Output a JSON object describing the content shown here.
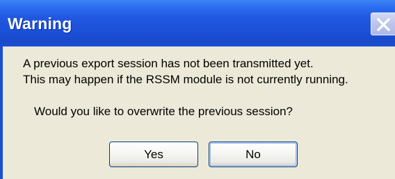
{
  "window": {
    "title": "Warning",
    "close_icon": "close-icon"
  },
  "message": {
    "line1": "A previous export session has not been transmitted yet.",
    "line2": "This may happen if the RSSM module is not currently running.",
    "question": "Would you like to overwrite the previous session?"
  },
  "buttons": {
    "yes_label": "Yes",
    "no_label": "No"
  },
  "colors": {
    "titlebar": "#2158e2",
    "client": "#ece9d8",
    "button_border": "#003c74"
  }
}
